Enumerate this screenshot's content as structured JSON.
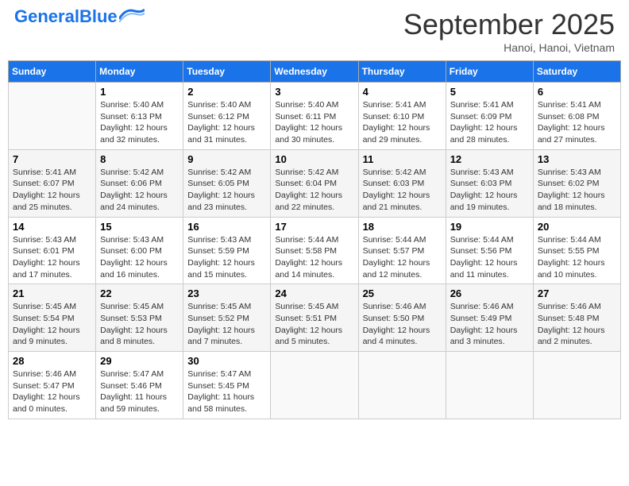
{
  "header": {
    "logo_general": "General",
    "logo_blue": "Blue",
    "month_title": "September 2025",
    "location": "Hanoi, Hanoi, Vietnam"
  },
  "weekdays": [
    "Sunday",
    "Monday",
    "Tuesday",
    "Wednesday",
    "Thursday",
    "Friday",
    "Saturday"
  ],
  "weeks": [
    [
      {
        "num": "",
        "info": ""
      },
      {
        "num": "1",
        "info": "Sunrise: 5:40 AM\nSunset: 6:13 PM\nDaylight: 12 hours\nand 32 minutes."
      },
      {
        "num": "2",
        "info": "Sunrise: 5:40 AM\nSunset: 6:12 PM\nDaylight: 12 hours\nand 31 minutes."
      },
      {
        "num": "3",
        "info": "Sunrise: 5:40 AM\nSunset: 6:11 PM\nDaylight: 12 hours\nand 30 minutes."
      },
      {
        "num": "4",
        "info": "Sunrise: 5:41 AM\nSunset: 6:10 PM\nDaylight: 12 hours\nand 29 minutes."
      },
      {
        "num": "5",
        "info": "Sunrise: 5:41 AM\nSunset: 6:09 PM\nDaylight: 12 hours\nand 28 minutes."
      },
      {
        "num": "6",
        "info": "Sunrise: 5:41 AM\nSunset: 6:08 PM\nDaylight: 12 hours\nand 27 minutes."
      }
    ],
    [
      {
        "num": "7",
        "info": "Sunrise: 5:41 AM\nSunset: 6:07 PM\nDaylight: 12 hours\nand 25 minutes."
      },
      {
        "num": "8",
        "info": "Sunrise: 5:42 AM\nSunset: 6:06 PM\nDaylight: 12 hours\nand 24 minutes."
      },
      {
        "num": "9",
        "info": "Sunrise: 5:42 AM\nSunset: 6:05 PM\nDaylight: 12 hours\nand 23 minutes."
      },
      {
        "num": "10",
        "info": "Sunrise: 5:42 AM\nSunset: 6:04 PM\nDaylight: 12 hours\nand 22 minutes."
      },
      {
        "num": "11",
        "info": "Sunrise: 5:42 AM\nSunset: 6:03 PM\nDaylight: 12 hours\nand 21 minutes."
      },
      {
        "num": "12",
        "info": "Sunrise: 5:43 AM\nSunset: 6:03 PM\nDaylight: 12 hours\nand 19 minutes."
      },
      {
        "num": "13",
        "info": "Sunrise: 5:43 AM\nSunset: 6:02 PM\nDaylight: 12 hours\nand 18 minutes."
      }
    ],
    [
      {
        "num": "14",
        "info": "Sunrise: 5:43 AM\nSunset: 6:01 PM\nDaylight: 12 hours\nand 17 minutes."
      },
      {
        "num": "15",
        "info": "Sunrise: 5:43 AM\nSunset: 6:00 PM\nDaylight: 12 hours\nand 16 minutes."
      },
      {
        "num": "16",
        "info": "Sunrise: 5:43 AM\nSunset: 5:59 PM\nDaylight: 12 hours\nand 15 minutes."
      },
      {
        "num": "17",
        "info": "Sunrise: 5:44 AM\nSunset: 5:58 PM\nDaylight: 12 hours\nand 14 minutes."
      },
      {
        "num": "18",
        "info": "Sunrise: 5:44 AM\nSunset: 5:57 PM\nDaylight: 12 hours\nand 12 minutes."
      },
      {
        "num": "19",
        "info": "Sunrise: 5:44 AM\nSunset: 5:56 PM\nDaylight: 12 hours\nand 11 minutes."
      },
      {
        "num": "20",
        "info": "Sunrise: 5:44 AM\nSunset: 5:55 PM\nDaylight: 12 hours\nand 10 minutes."
      }
    ],
    [
      {
        "num": "21",
        "info": "Sunrise: 5:45 AM\nSunset: 5:54 PM\nDaylight: 12 hours\nand 9 minutes."
      },
      {
        "num": "22",
        "info": "Sunrise: 5:45 AM\nSunset: 5:53 PM\nDaylight: 12 hours\nand 8 minutes."
      },
      {
        "num": "23",
        "info": "Sunrise: 5:45 AM\nSunset: 5:52 PM\nDaylight: 12 hours\nand 7 minutes."
      },
      {
        "num": "24",
        "info": "Sunrise: 5:45 AM\nSunset: 5:51 PM\nDaylight: 12 hours\nand 5 minutes."
      },
      {
        "num": "25",
        "info": "Sunrise: 5:46 AM\nSunset: 5:50 PM\nDaylight: 12 hours\nand 4 minutes."
      },
      {
        "num": "26",
        "info": "Sunrise: 5:46 AM\nSunset: 5:49 PM\nDaylight: 12 hours\nand 3 minutes."
      },
      {
        "num": "27",
        "info": "Sunrise: 5:46 AM\nSunset: 5:48 PM\nDaylight: 12 hours\nand 2 minutes."
      }
    ],
    [
      {
        "num": "28",
        "info": "Sunrise: 5:46 AM\nSunset: 5:47 PM\nDaylight: 12 hours\nand 0 minutes."
      },
      {
        "num": "29",
        "info": "Sunrise: 5:47 AM\nSunset: 5:46 PM\nDaylight: 11 hours\nand 59 minutes."
      },
      {
        "num": "30",
        "info": "Sunrise: 5:47 AM\nSunset: 5:45 PM\nDaylight: 11 hours\nand 58 minutes."
      },
      {
        "num": "",
        "info": ""
      },
      {
        "num": "",
        "info": ""
      },
      {
        "num": "",
        "info": ""
      },
      {
        "num": "",
        "info": ""
      }
    ]
  ]
}
